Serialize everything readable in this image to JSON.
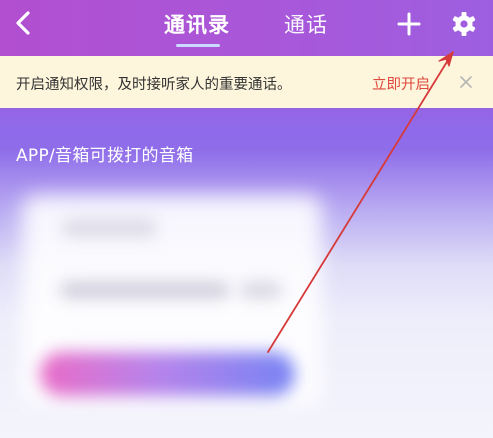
{
  "header": {
    "tabs": [
      {
        "label": "通讯录",
        "active": true
      },
      {
        "label": "通话",
        "active": false
      }
    ],
    "icons": {
      "back": "chevron-left-icon",
      "add": "plus-icon",
      "settings": "gear-icon"
    }
  },
  "notice": {
    "text": "开启通知权限，及时接听家人的重要通话。",
    "action_label": "立即开启",
    "close_icon": "close-icon"
  },
  "section": {
    "title": "APP/音箱可拨打的音箱"
  },
  "colors": {
    "nav_bg": "#b14fd0",
    "notice_bg": "#fdf6dd",
    "notice_action": "#e0473d",
    "annotation_arrow": "#d63a3a"
  }
}
